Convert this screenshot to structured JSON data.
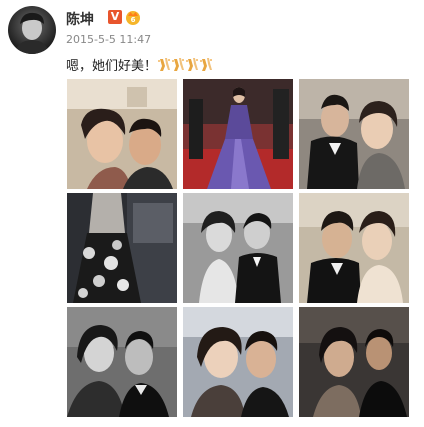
{
  "post": {
    "author_name": "陈坤",
    "vip_badge": "V",
    "level_badge_icon": "crown-level-icon",
    "timestamp": "2015-5-5 11:47",
    "text": "嗯，她们好美！",
    "emoji_icon": "hands-clap-emoji",
    "emoji_count": 4
  },
  "photos": [
    {
      "name": "photo-1",
      "description_icon": "selfie-couple-photo"
    },
    {
      "name": "photo-2",
      "description_icon": "purple-gown-photo"
    },
    {
      "name": "photo-3",
      "description_icon": "tuxedo-couple-photo"
    },
    {
      "name": "photo-4",
      "description_icon": "floral-dress-photo"
    },
    {
      "name": "photo-5",
      "description_icon": "bw-couple-photo"
    },
    {
      "name": "photo-6",
      "description_icon": "tuxedo-kiss-photo"
    },
    {
      "name": "photo-7",
      "description_icon": "bw-selfie-photo"
    },
    {
      "name": "photo-8",
      "description_icon": "smiling-selfie-photo"
    },
    {
      "name": "photo-9",
      "description_icon": "dark-selfie-photo"
    }
  ],
  "colors": {
    "vip_orange": "#e8552d",
    "timestamp_gray": "#888888",
    "emoji_gold": "#e8a640"
  }
}
